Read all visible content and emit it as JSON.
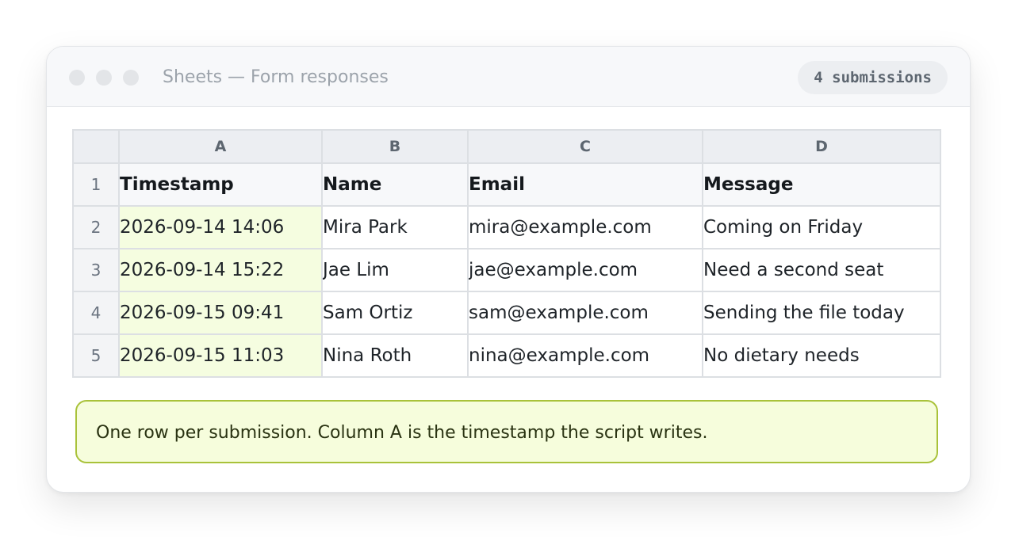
{
  "window": {
    "title": "Sheets — Form responses",
    "badge": "4 submissions"
  },
  "sheet": {
    "columns": [
      "A",
      "B",
      "C",
      "D"
    ],
    "header_row_number": "1",
    "headers": [
      "Timestamp",
      "Name",
      "Email",
      "Message"
    ],
    "rows": [
      {
        "number": "2",
        "cells": [
          "2026-09-14 14:06",
          "Mira Park",
          "mira@example.com",
          "Coming on Friday"
        ]
      },
      {
        "number": "3",
        "cells": [
          "2026-09-14 15:22",
          "Jae Lim",
          "jae@example.com",
          "Need a second seat"
        ]
      },
      {
        "number": "4",
        "cells": [
          "2026-09-15 09:41",
          "Sam Ortiz",
          "sam@example.com",
          "Sending the file today"
        ]
      },
      {
        "number": "5",
        "cells": [
          "2026-09-15 11:03",
          "Nina Roth",
          "nina@example.com",
          "No dietary needs"
        ]
      }
    ]
  },
  "note": {
    "text": "One row per submission. Column A is the timestamp the script writes."
  },
  "colors": {
    "highlight_column_fill": "#f5fde0",
    "note_border": "#a9c23a",
    "note_fill": "#f6fddc"
  }
}
